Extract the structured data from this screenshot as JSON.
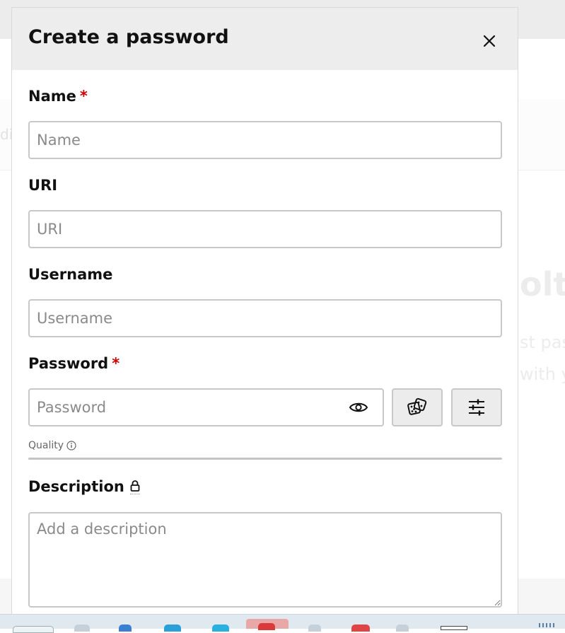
{
  "background": {
    "edge_text": "di",
    "heading": "olt",
    "subtitle_1": "st pas",
    "subtitle_2": "with y"
  },
  "dialog": {
    "title": "Create a password",
    "close_icon": "close-icon"
  },
  "form": {
    "name": {
      "label": "Name",
      "required_mark": "*",
      "placeholder": "Name",
      "value": ""
    },
    "uri": {
      "label": "URI",
      "placeholder": "URI",
      "value": ""
    },
    "username": {
      "label": "Username",
      "placeholder": "Username",
      "value": ""
    },
    "password": {
      "label": "Password",
      "required_mark": "*",
      "placeholder": "Password",
      "value": "",
      "visibility_icon": "eye-icon",
      "generate_icon": "dice-icon",
      "settings_icon": "sliders-icon"
    },
    "quality": {
      "label": "Quality",
      "info_icon": "info-icon",
      "level": 0
    },
    "description": {
      "label": "Description",
      "lock_icon": "lock-icon",
      "placeholder": "Add a description",
      "value": ""
    }
  },
  "colors": {
    "required": "#d40000",
    "header_bg": "#ededed",
    "border": "#c8c8c8",
    "button_bg": "#ececec"
  }
}
